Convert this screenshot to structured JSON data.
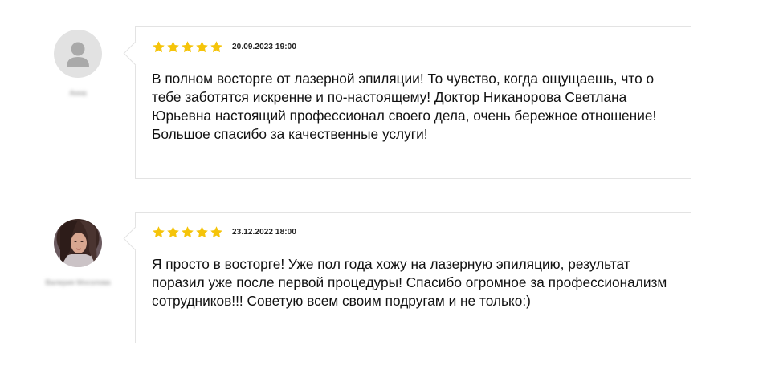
{
  "colors": {
    "star": "#f5c40a",
    "border": "#e3e3e3",
    "text": "#111111"
  },
  "reviews": [
    {
      "author": "Анна",
      "avatar": "default-user-icon",
      "rating": 5,
      "date": "20.09.2023 19:00",
      "text": "В полном восторге от лазерной эпиляции! То чувство, когда ощущаешь, что о тебе заботятся искренне и по-настоящему! Доктор Никанорова Светлана Юрьевна настоящий профессионал своего дела, очень бережное отношение! Большое спасибо за качественные услуги!"
    },
    {
      "author": "Валерия Мосолова",
      "avatar": "user-photo",
      "rating": 5,
      "date": "23.12.2022 18:00",
      "text": "Я просто в восторге! Уже пол года хожу на лазерную эпиляцию, результат поразил уже после первой процедуры! Спасибо огромное за профессионализм сотрудников!!! Советую всем своим подругам и не только:)"
    }
  ]
}
